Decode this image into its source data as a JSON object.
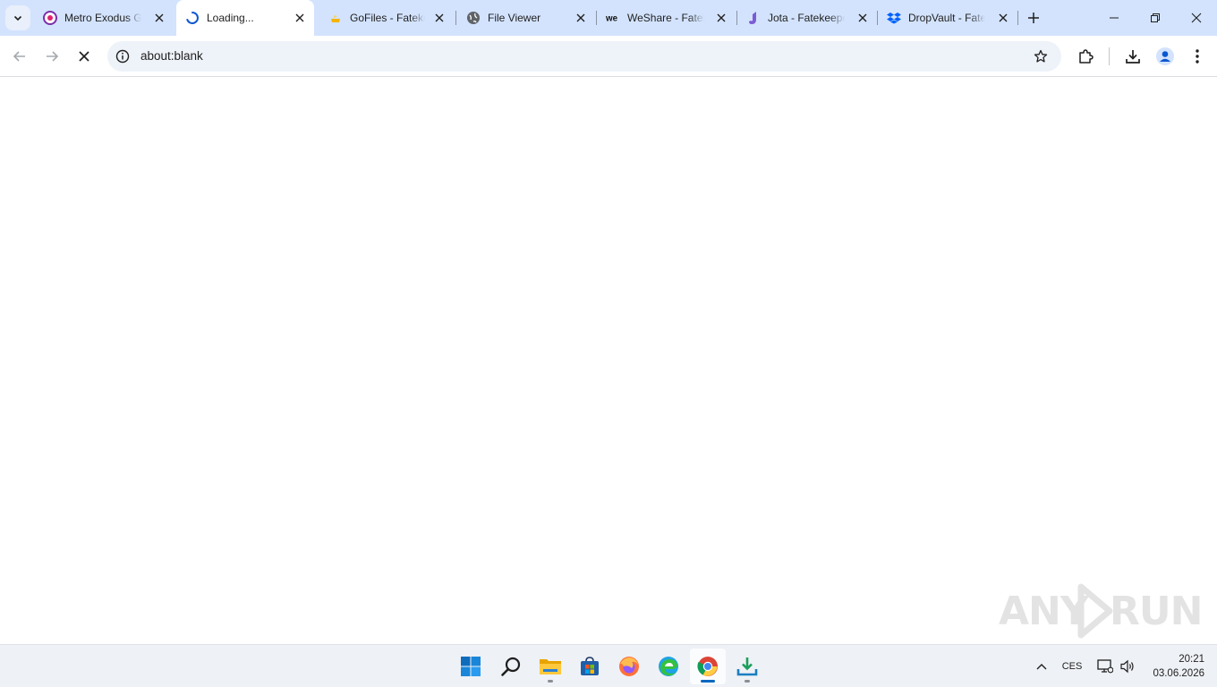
{
  "browser": {
    "tabs": [
      {
        "title": "Metro Exodus Gold Edition",
        "favicon": "metro-exodus-icon",
        "active": false
      },
      {
        "title": "Loading...",
        "favicon": "loading-spinner-icon",
        "active": true
      },
      {
        "title": "GoFiles - Fatekeeper",
        "favicon": "gofiles-icon",
        "active": false
      },
      {
        "title": "File Viewer",
        "favicon": "globe-icon",
        "active": false
      },
      {
        "title": "WeShare - Fatekeeper",
        "favicon": "weshare-icon",
        "active": false
      },
      {
        "title": "Jota - Fatekeeper",
        "favicon": "jota-icon",
        "active": false
      },
      {
        "title": "DropVault - Fatekeeper",
        "favicon": "dropbox-icon",
        "active": false
      }
    ],
    "address_bar": {
      "url": "about:blank"
    }
  },
  "taskbar": {
    "apps": [
      "start-icon",
      "search-icon",
      "file-explorer-icon",
      "store-icon",
      "firefox-icon",
      "edge-icon",
      "chrome-icon",
      "installer-download-icon"
    ],
    "language": "CES",
    "time": "20:21",
    "date": "03.06.2026"
  },
  "watermark": {
    "text_left": "ANY",
    "text_right": "RUN"
  },
  "colors": {
    "tabstrip": "#d3e3fd",
    "omnibox": "#eef2f9",
    "accent": "#0b57d0",
    "taskbar": "#eef1f5"
  }
}
